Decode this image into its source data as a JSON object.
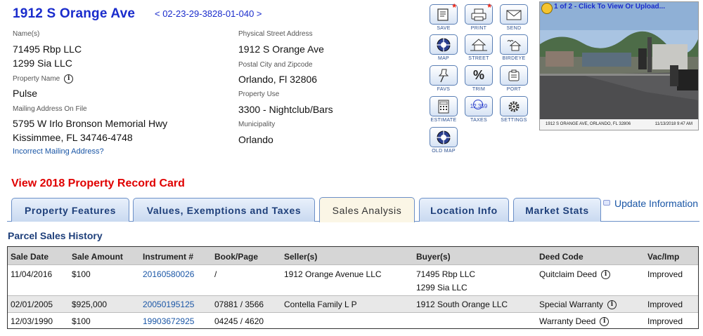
{
  "header": {
    "title": "1912 S Orange Ave",
    "parcel_id": "< 02-23-29-3828-01-040 >"
  },
  "left": {
    "names_label": "Name(s)",
    "name1": "71495 Rbp LLC",
    "name2": "1299 Sia LLC",
    "property_name_label": "Property Name",
    "property_name": "Pulse",
    "mailing_label": "Mailing Address On File",
    "mailing_line1": "5795 W Irlo Bronson Memorial Hwy",
    "mailing_line2": "Kissimmee, FL 34746-4748",
    "incorrect_link": "Incorrect Mailing Address?"
  },
  "middle": {
    "street_label": "Physical Street Address",
    "street": "1912 S Orange Ave",
    "postal_label": "Postal City and Zipcode",
    "postal": "Orlando, Fl 32806",
    "use_label": "Property Use",
    "use": "3300 - Nightclub/Bars",
    "muni_label": "Municipality",
    "muni": "Orlando"
  },
  "toolbar": {
    "save": "SAVE",
    "print": "PRINT",
    "send": "SEND",
    "map": "MAP",
    "street": "STREET",
    "birdeye": "BIRDEYE",
    "favs": "FAVS",
    "trim": "TRIM",
    "port": "PORT",
    "estimate": "ESTIMATE",
    "taxes": "TAXES",
    "settings": "SETTINGS",
    "old_map": "OLD MAP",
    "taxes_icon_text": "12,359",
    "trim_glyph": "%"
  },
  "photo": {
    "top_text": "1 of 2 - Click To View Or Upload...",
    "caption_left": "1912 S ORANGE AVE, ORLANDO, FL 32806",
    "caption_right": "11/13/2018 9:47 AM"
  },
  "record_card_link": "View 2018 Property Record Card",
  "tabs": [
    {
      "label": "Property Features"
    },
    {
      "label": "Values, Exemptions and Taxes"
    },
    {
      "label": "Sales Analysis"
    },
    {
      "label": "Location Info"
    },
    {
      "label": "Market Stats"
    }
  ],
  "update_info": "Update Information",
  "section_title": "Parcel Sales History",
  "table": {
    "headers": [
      "Sale Date",
      "Sale Amount",
      "Instrument #",
      "Book/Page",
      "Seller(s)",
      "Buyer(s)",
      "Deed Code",
      "Vac/Imp"
    ],
    "rows": [
      {
        "date": "11/04/2016",
        "amount": "$100",
        "instrument": "20160580026",
        "book": "/",
        "seller": "1912 Orange Avenue LLC",
        "buyer1": "71495 Rbp LLC",
        "buyer2": "1299 Sia LLC",
        "deed": "Quitclaim Deed",
        "vac": "Improved"
      },
      {
        "date": "02/01/2005",
        "amount": "$925,000",
        "instrument": "20050195125",
        "book": "07881 / 3566",
        "seller": "Contella Family L P",
        "buyer1": "1912 South Orange LLC",
        "buyer2": "",
        "deed": "Special Warranty",
        "vac": "Improved"
      },
      {
        "date": "12/03/1990",
        "amount": "$100",
        "instrument": "19903672925",
        "book": "04245 / 4620",
        "seller": "",
        "buyer1": "",
        "buyer2": "",
        "deed": "Warranty Deed",
        "vac": "Improved"
      }
    ]
  },
  "colors": {
    "title_blue": "#1a2ccc",
    "link_blue": "#1a56a6",
    "record_red": "#e00000",
    "tab_text": "#1e3f7a"
  }
}
